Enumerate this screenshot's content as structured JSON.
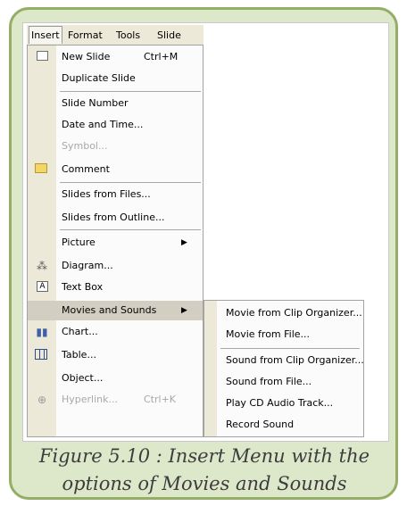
{
  "menubar": {
    "items": [
      {
        "label": "Insert"
      },
      {
        "label": "Format"
      },
      {
        "label": "Tools"
      },
      {
        "label": "Slide"
      }
    ]
  },
  "insert_menu": {
    "items": [
      {
        "label": "New Slide",
        "shortcut": "Ctrl+M",
        "icon": "new-slide-icon"
      },
      {
        "label": "Duplicate Slide"
      },
      {
        "label": "Slide Number"
      },
      {
        "label": "Date and Time..."
      },
      {
        "label": "Symbol...",
        "disabled": true
      },
      {
        "label": "Comment",
        "icon": "comment-icon"
      },
      {
        "label": "Slides from Files..."
      },
      {
        "label": "Slides from Outline..."
      },
      {
        "label": "Picture",
        "submenu": true
      },
      {
        "label": "Diagram...",
        "icon": "diagram-icon"
      },
      {
        "label": "Text Box",
        "icon": "text-box-icon"
      },
      {
        "label": "Movies and Sounds",
        "submenu": true,
        "highlighted": true
      },
      {
        "label": "Chart...",
        "icon": "chart-icon"
      },
      {
        "label": "Table...",
        "icon": "table-icon"
      },
      {
        "label": "Object..."
      },
      {
        "label": "Hyperlink...",
        "shortcut": "Ctrl+K",
        "disabled": true,
        "icon": "hyperlink-icon"
      }
    ]
  },
  "submenu": {
    "items": [
      {
        "label": "Movie from Clip Organizer..."
      },
      {
        "label": "Movie from File..."
      },
      {
        "label": "Sound from Clip Organizer..."
      },
      {
        "label": "Sound from File..."
      },
      {
        "label": "Play CD Audio Track..."
      },
      {
        "label": "Record Sound"
      }
    ]
  },
  "caption": {
    "line1": "Figure 5.10 : Insert Menu with the",
    "line2": "options of Movies and Sounds"
  },
  "colors": {
    "frame_fill": "#dde7c9",
    "frame_border": "#95ae66",
    "menu_gutter": "#ece9d8",
    "highlight": "#d2cfc2"
  }
}
